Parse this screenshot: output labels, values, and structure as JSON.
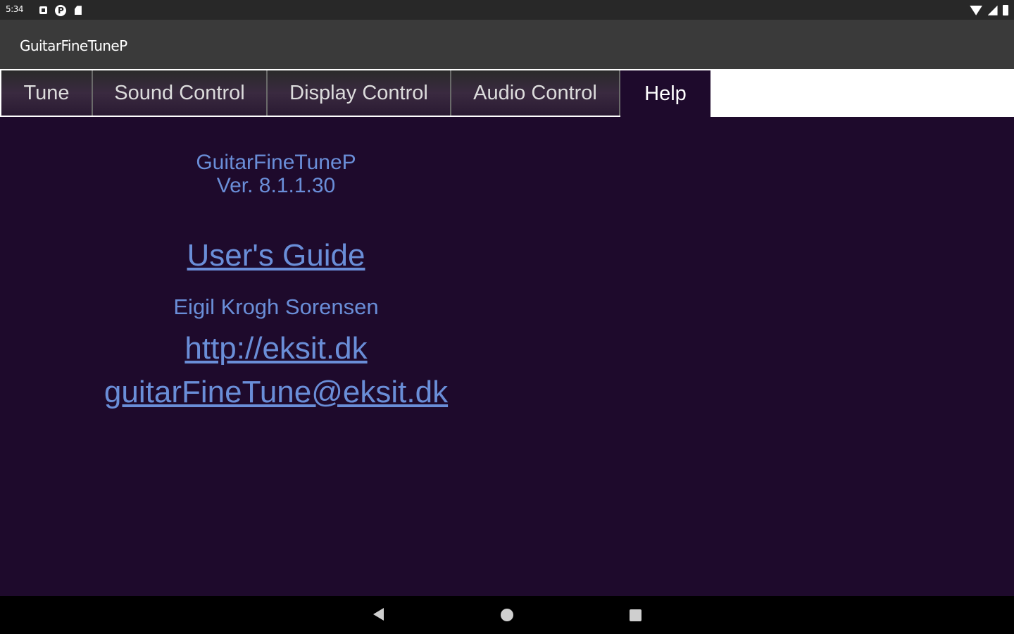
{
  "status_bar": {
    "time": "5:34",
    "left_icons": [
      "notification-square-icon",
      "notification-p-icon",
      "sd-card-icon"
    ],
    "right_icons": [
      "wifi-icon",
      "cell-signal-icon",
      "battery-icon"
    ]
  },
  "app_bar": {
    "title": "GuitarFineTuneP"
  },
  "tabs": [
    {
      "label": "Tune",
      "active": false
    },
    {
      "label": "Sound Control",
      "active": false
    },
    {
      "label": "Display Control",
      "active": false
    },
    {
      "label": "Audio Control",
      "active": false
    },
    {
      "label": "Help",
      "active": true
    }
  ],
  "help": {
    "app_name": "GuitarFineTuneP",
    "version": "Ver. 8.1.1.30",
    "users_guide_link": "User's Guide",
    "author": "Eigil Krogh Sorensen",
    "website_link": "http://eksit.dk",
    "email_link": "guitarFineTune@eksit.dk"
  },
  "colors": {
    "background": "#1e0a2c",
    "text_accent": "#6a8ed8",
    "app_bar": "#3a3a3a",
    "status_bar": "#282828"
  },
  "nav_bar": {
    "buttons": [
      "back-icon",
      "home-icon",
      "recents-icon"
    ]
  }
}
